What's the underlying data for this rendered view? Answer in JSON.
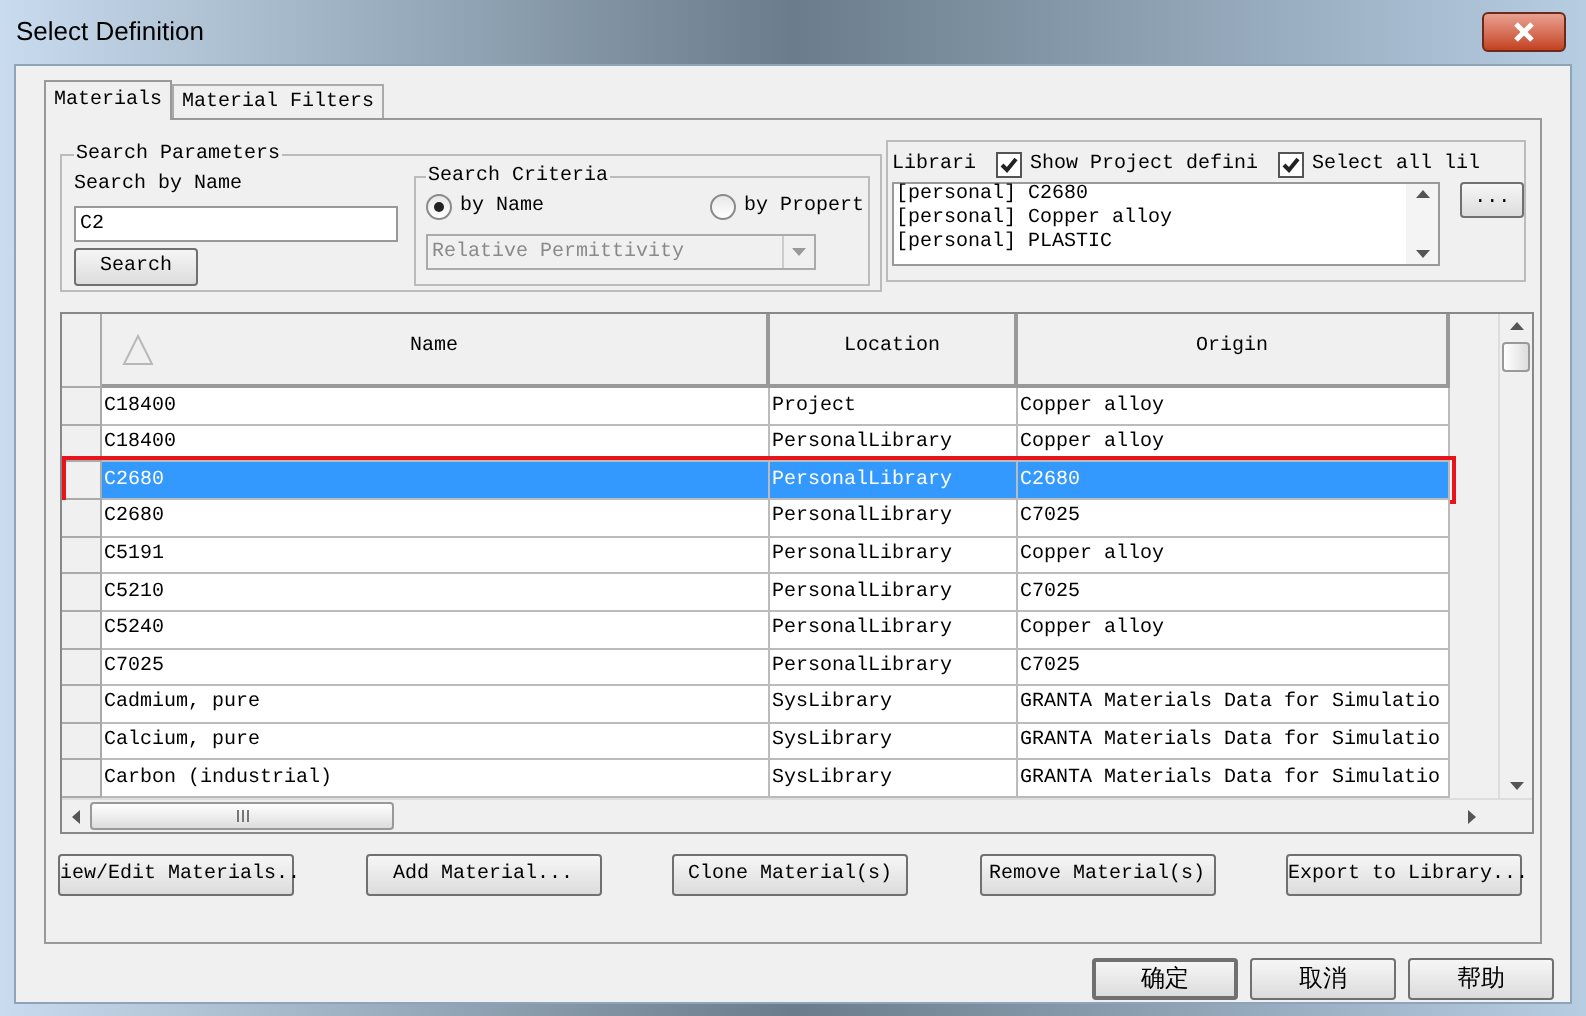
{
  "window": {
    "title": "Select Definition"
  },
  "tabs": [
    {
      "label": "Materials",
      "selected": true
    },
    {
      "label": "Material Filters",
      "selected": false
    }
  ],
  "search_parameters": {
    "title": "Search Parameters",
    "name_label": "Search by Name",
    "name_value": "C2",
    "search_button": "Search"
  },
  "search_criteria": {
    "title": "Search Criteria",
    "options": [
      {
        "label": "by Name",
        "selected": true
      },
      {
        "label": "by Propert",
        "selected": false
      }
    ],
    "property_value": "Relative Permittivity",
    "property_disabled": true
  },
  "libraries": {
    "label": "Librari",
    "checkboxes": [
      {
        "label": "Show Project defini",
        "checked": true
      },
      {
        "label": "Select all lil",
        "checked": true
      }
    ],
    "items": [
      "[personal] C2680",
      "[personal] Copper alloy",
      "[personal] PLASTIC"
    ],
    "browse_button": "..."
  },
  "table": {
    "columns": [
      "Name",
      "Location",
      "Origin"
    ],
    "rows": [
      {
        "cells": [
          "C18400",
          "Project",
          "Copper alloy"
        ],
        "selected": false,
        "annotated": false
      },
      {
        "cells": [
          "C18400",
          "PersonalLibrary",
          "Copper alloy"
        ],
        "selected": false,
        "annotated": false
      },
      {
        "cells": [
          "C2680",
          "PersonalLibrary",
          "C2680"
        ],
        "selected": true,
        "annotated": true
      },
      {
        "cells": [
          "C2680",
          "PersonalLibrary",
          "C7025"
        ],
        "selected": false,
        "annotated": false
      },
      {
        "cells": [
          "C5191",
          "PersonalLibrary",
          "Copper alloy"
        ],
        "selected": false,
        "annotated": false
      },
      {
        "cells": [
          "C5210",
          "PersonalLibrary",
          "C7025"
        ],
        "selected": false,
        "annotated": false
      },
      {
        "cells": [
          "C5240",
          "PersonalLibrary",
          "Copper alloy"
        ],
        "selected": false,
        "annotated": false
      },
      {
        "cells": [
          "C7025",
          "PersonalLibrary",
          "C7025"
        ],
        "selected": false,
        "annotated": false
      },
      {
        "cells": [
          "Cadmium, pure",
          "SysLibrary",
          "GRANTA Materials Data for Simulatio"
        ],
        "selected": false,
        "annotated": false
      },
      {
        "cells": [
          "Calcium, pure",
          "SysLibrary",
          "GRANTA Materials Data for Simulatio"
        ],
        "selected": false,
        "annotated": false
      },
      {
        "cells": [
          "Carbon (industrial)",
          "SysLibrary",
          "GRANTA Materials Data for Simulatio"
        ],
        "selected": false,
        "annotated": false
      }
    ]
  },
  "action_buttons": [
    "iew/Edit Materials..",
    "Add Material...",
    "Clone Material(s)",
    "Remove Material(s)",
    "Export to Library..."
  ],
  "dialog_buttons": [
    "确定",
    "取消",
    "帮助"
  ]
}
